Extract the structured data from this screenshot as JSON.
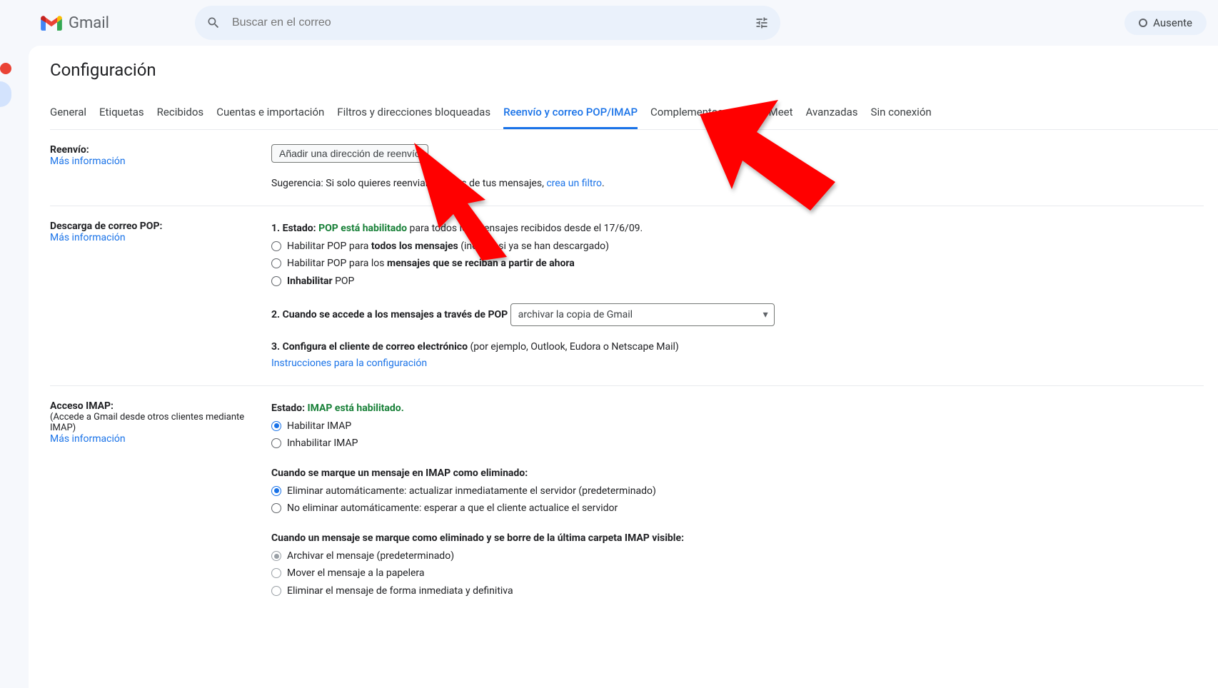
{
  "header": {
    "product_name": "Gmail",
    "search_placeholder": "Buscar en el correo",
    "status_label": "Ausente"
  },
  "page": {
    "title": "Configuración"
  },
  "tabs": [
    {
      "label": "General"
    },
    {
      "label": "Etiquetas"
    },
    {
      "label": "Recibidos"
    },
    {
      "label": "Cuentas e importación"
    },
    {
      "label": "Filtros y direcciones bloqueadas"
    },
    {
      "label": "Reenvío y correo POP/IMAP",
      "active": true
    },
    {
      "label": "Complementos"
    },
    {
      "label": "Chat y Meet"
    },
    {
      "label": "Avanzadas"
    },
    {
      "label": "Sin conexión"
    }
  ],
  "forwarding": {
    "title": "Reenvío:",
    "more_info": "Más información",
    "add_button": "Añadir una dirección de reenvío",
    "tip_prefix": "Sugerencia: Si solo quieres reenviar algunos de tus mensajes, ",
    "tip_link": "crea un filtro",
    "tip_suffix": "."
  },
  "pop": {
    "title": "Descarga de correo POP:",
    "more_info": "Más información",
    "status_prefix": "1. Estado: ",
    "status_value": "POP está habilitado",
    "status_suffix": " para todos los mensajes recibidos desde el 17/6/09.",
    "opt1_a": "Habilitar POP para ",
    "opt1_b": "todos los mensajes",
    "opt1_c": " (incluso si ya se han descargado)",
    "opt2_a": "Habilitar POP para los ",
    "opt2_b": "mensajes que se reciban a partir de ahora",
    "opt3_a": "Inhabilitar",
    "opt3_b": " POP",
    "access_label": "2. Cuando se accede a los mensajes a través de POP",
    "access_select": "archivar la copia de Gmail",
    "step3_a": "3. Configura el cliente de correo electrónico",
    "step3_b": " (por ejemplo, Outlook, Eudora o Netscape Mail)",
    "instructions_link": "Instrucciones para la configuración"
  },
  "imap": {
    "title": "Acceso IMAP:",
    "subtitle": "(Accede a Gmail desde otros clientes mediante IMAP)",
    "more_info": "Más información",
    "status_prefix": "Estado: ",
    "status_value": "IMAP está habilitado.",
    "enable": "Habilitar IMAP",
    "disable": "Inhabilitar IMAP",
    "deleted_heading": "Cuando se marque un mensaje en IMAP como eliminado:",
    "del_opt1": "Eliminar automáticamente: actualizar inmediatamente el servidor (predeterminado)",
    "del_opt2": "No eliminar automáticamente: esperar a que el cliente actualice el servidor",
    "expunge_heading": "Cuando un mensaje se marque como eliminado y se borre de la última carpeta IMAP visible:",
    "exp_opt1": "Archivar el mensaje (predeterminado)",
    "exp_opt2": "Mover el mensaje a la papelera",
    "exp_opt3": "Eliminar el mensaje de forma inmediata y definitiva"
  }
}
